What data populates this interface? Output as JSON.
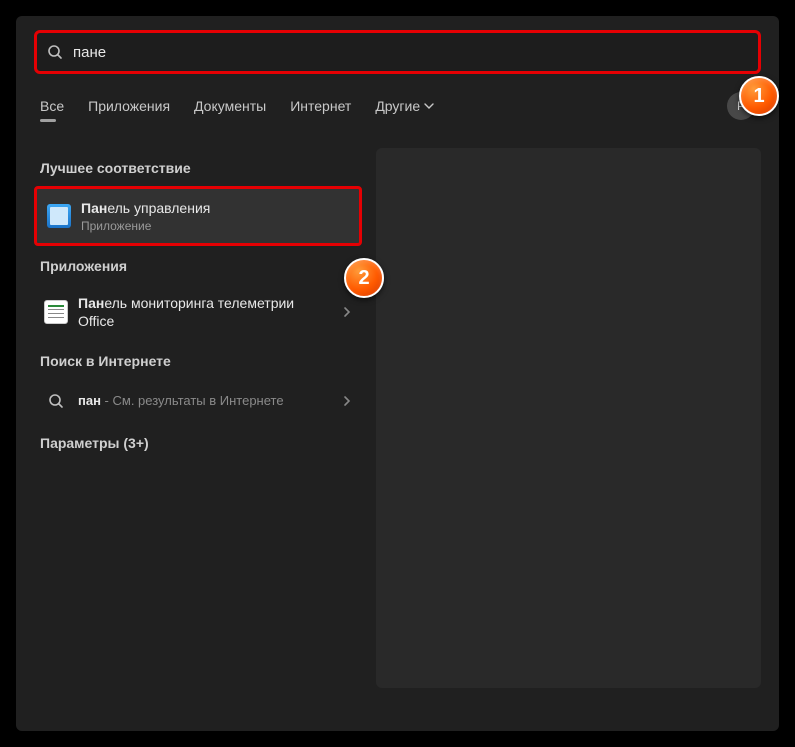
{
  "search": {
    "value": "пане"
  },
  "tabs": {
    "items": [
      {
        "label": "Все",
        "active": true
      },
      {
        "label": "Приложения"
      },
      {
        "label": "Документы"
      },
      {
        "label": "Интернет"
      },
      {
        "label": "Другие",
        "chevron": true
      }
    ],
    "userInitial": "P"
  },
  "sections": {
    "bestMatch": "Лучшее соответствие",
    "apps": "Приложения",
    "internet": "Поиск в Интернете",
    "settings": "Параметры (3+)"
  },
  "results": {
    "best": {
      "titlePrefix": "Пан",
      "titleRest": "ель управления",
      "subtitle": "Приложение"
    },
    "app1": {
      "titlePrefix": "Пан",
      "titleRest": "ель мониторинга телеметрии Office"
    },
    "internet": {
      "query": "пан",
      "suffix": " - См. результаты в Интернете"
    }
  },
  "callouts": {
    "c1": "1",
    "c2": "2"
  }
}
